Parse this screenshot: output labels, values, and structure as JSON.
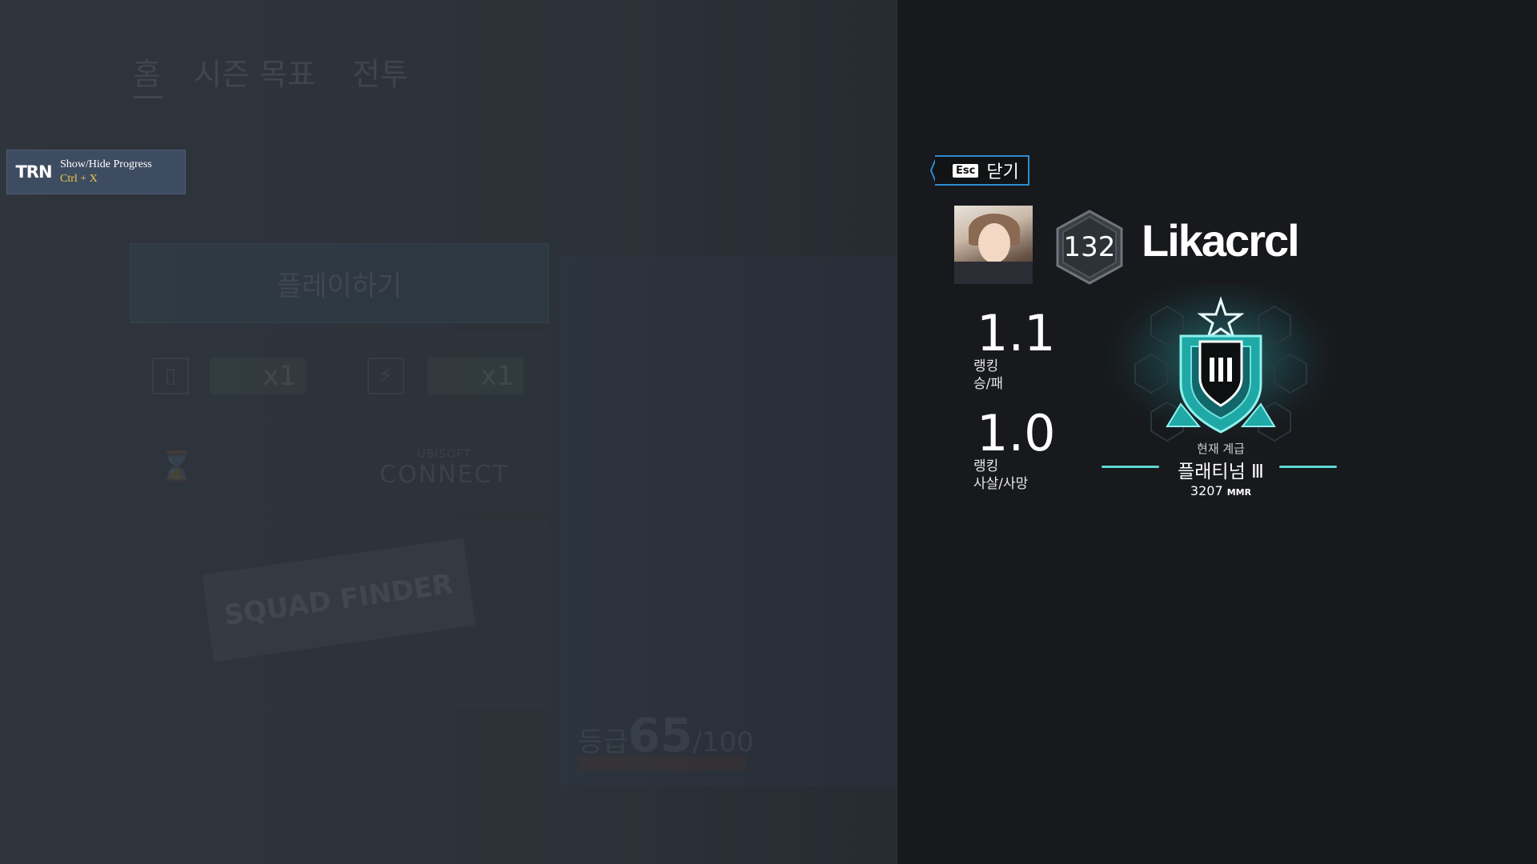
{
  "background": {
    "tabs": [
      "홈",
      "시즌 목표",
      "전투"
    ],
    "play_button_label": "플레이하기",
    "pill_1": "x1",
    "pill_2": "x1",
    "connect_small": "UBISOFT",
    "connect_big": "CONNECT",
    "banner_text": "SQUAD FINDER",
    "level_prefix": "등급",
    "level_value": "65",
    "level_max": "/100"
  },
  "trn": {
    "logo": "TRN",
    "title": "Show/Hide Progress",
    "shortcut": "Ctrl + X"
  },
  "profile": {
    "close_key": "Esc",
    "close_label": "닫기",
    "level": "132",
    "username": "Likacrcl",
    "stats": [
      {
        "value": "1.1",
        "label_line1": "랭킹",
        "label_line2": "승/패"
      },
      {
        "value": "1.0",
        "label_line1": "랭킹",
        "label_line2": "사살/사망"
      }
    ],
    "rank": {
      "caption": "현재 계급",
      "name": "플래티넘 Ⅲ",
      "mmr_value": "3207",
      "mmr_unit": "MMR",
      "accent_color": "#5fd9d4"
    }
  }
}
